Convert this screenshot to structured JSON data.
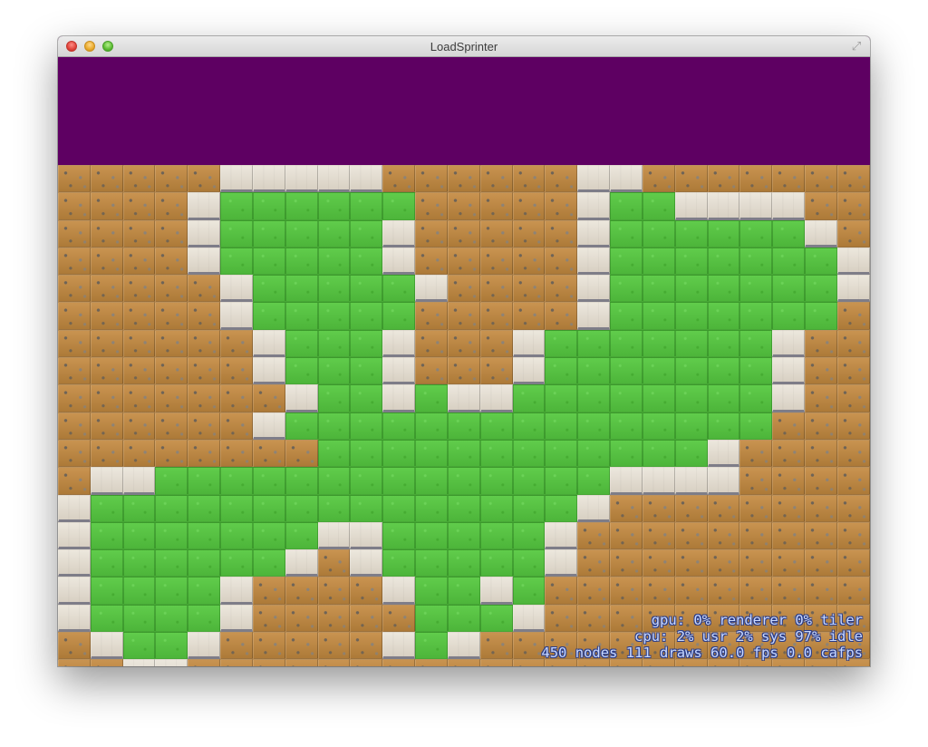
{
  "window": {
    "title": "LoadSprinter"
  },
  "scene": {
    "background_color": "#5e0062",
    "tile_legend": {
      "d": "dirt",
      "g": "grass",
      "s": "stone"
    },
    "tilemap": [
      "dddddsssssddddddssddddddd",
      "ddddsggggggdddddsggssssdd",
      "ddddsgggggsdddddsggggggsd",
      "ddddsgggggsdddddsgggggggs",
      "dddddsgggggsddddsgggggggs",
      "dddddsgggggdddddsgggggggd",
      "ddddddsgggsdddsgggggggsdd",
      "ddddddsgggsdddsgggggggsdd",
      "dddddddsggsgssggggggggsdd",
      "ddddddsgggggggggggggggddd",
      "ddddddddggggggggggggsdddd",
      "dssggggggggggggggssssddddd",
      "sgggggggggggggggsdddddddd",
      "sgggggggssgggggsdddddddddd",
      "sggggggsdsgggggsddddddddd",
      "sggggsddddsggsgdddddddddd",
      "sggggsdddddgggsdddddddddd",
      "dsggsdddddsgsdddddddddddd",
      "ddssdddddddddddddddddddddd"
    ]
  },
  "stats": {
    "line1": "gpu: 0% renderer 0% tiler",
    "line2": "cpu: 2% usr 2% sys 97% idle",
    "line3": "450 nodes 111 draws 60.0 fps 0.0 cafps"
  }
}
